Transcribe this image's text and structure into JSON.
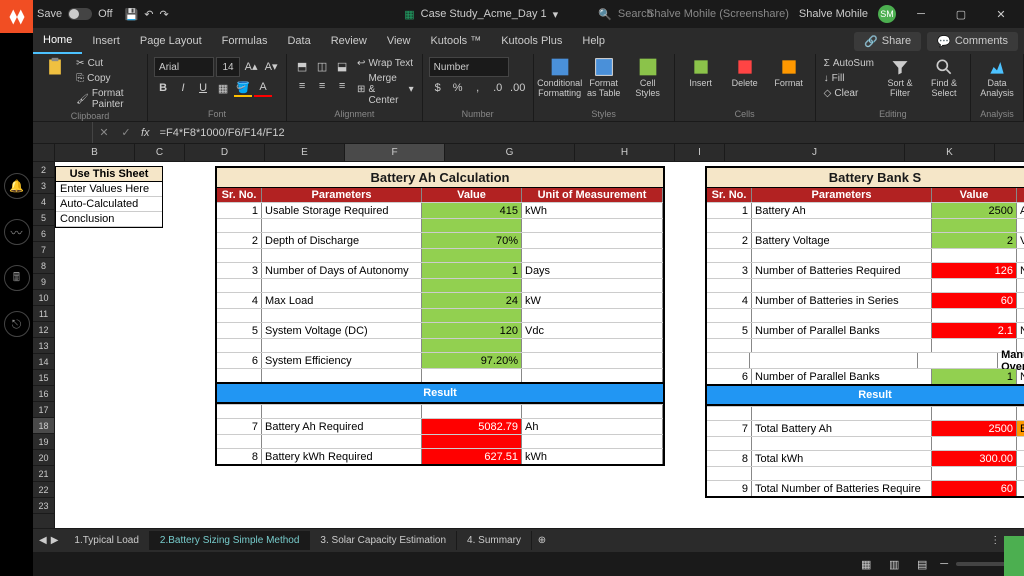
{
  "file": {
    "name": "Case Study_Acme_Day 1",
    "save": "Save",
    "on": "On",
    "off": "Off"
  },
  "search": {
    "placeholder": "Search"
  },
  "user": {
    "name": "Shalve Mohile",
    "screenshare": "Shalve Mohile (Screenshare)",
    "initials": "SM"
  },
  "tabs": {
    "home": "Home",
    "insert": "Insert",
    "layout": "Page Layout",
    "formulas": "Formulas",
    "data": "Data",
    "review": "Review",
    "view": "View",
    "kutools": "Kutools ™",
    "kutoolsplus": "Kutools Plus",
    "help": "Help",
    "share": "Share",
    "comments": "Comments"
  },
  "ribbon": {
    "clipboard": {
      "label": "Clipboard",
      "cut": "Cut",
      "copy": "Copy",
      "painter": "Format Painter"
    },
    "font": {
      "label": "Font",
      "name": "Arial",
      "size": "14"
    },
    "alignment": {
      "label": "Alignment",
      "wrap": "Wrap Text",
      "merge": "Merge & Center"
    },
    "number": {
      "label": "Number",
      "format": "Number"
    },
    "styles": {
      "label": "Styles",
      "cond": "Conditional Formatting",
      "table": "Format as Table",
      "cell": "Cell Styles"
    },
    "cells": {
      "label": "Cells",
      "insert": "Insert",
      "delete": "Delete",
      "format": "Format"
    },
    "editing": {
      "label": "Editing",
      "autosum": "AutoSum",
      "fill": "Fill",
      "clear": "Clear",
      "sort": "Sort & Filter",
      "find": "Find & Select"
    },
    "analysis": {
      "label": "Analysis",
      "data": "Data Analysis"
    }
  },
  "formula": {
    "value": "=F4*F8*1000/F6/F14/F12"
  },
  "cols": [
    "B",
    "C",
    "D",
    "E",
    "F",
    "G",
    "H",
    "I",
    "J",
    "K"
  ],
  "rows": [
    "2",
    "3",
    "4",
    "5",
    "6",
    "7",
    "8",
    "9",
    "10",
    "11",
    "12",
    "13",
    "14",
    "15",
    "16",
    "17",
    "18",
    "19",
    "20",
    "21",
    "22",
    "23"
  ],
  "legend": {
    "title": "Use This Sheet",
    "a": "Enter Values Here",
    "b": "Auto-Calculated",
    "c": "Conclusion"
  },
  "tableA": {
    "title": "Battery Ah Calculation",
    "h": {
      "sr": "Sr. No.",
      "param": "Parameters",
      "val": "Value",
      "unit": "Unit of Measurement"
    },
    "r1": {
      "sr": "1",
      "p": "Usable Storage Required",
      "v": "415",
      "u": "kWh"
    },
    "r2": {
      "sr": "2",
      "p": "Depth of Discharge",
      "v": "70%",
      "u": ""
    },
    "r3": {
      "sr": "3",
      "p": "Number of Days of Autonomy",
      "v": "1",
      "u": "Days"
    },
    "r4": {
      "sr": "4",
      "p": "Max Load",
      "v": "24",
      "u": "kW"
    },
    "r5": {
      "sr": "5",
      "p": "System Voltage (DC)",
      "v": "120",
      "u": "Vdc"
    },
    "r6": {
      "sr": "6",
      "p": "System Efficiency",
      "v": "97.20%",
      "u": ""
    },
    "result": "Result",
    "r7": {
      "sr": "7",
      "p": "Battery Ah Required",
      "v": "5082.79",
      "u": "Ah"
    },
    "r8": {
      "sr": "8",
      "p": "Battery kWh Required",
      "v": "627.51",
      "u": "kWh"
    }
  },
  "tableB": {
    "title": "Battery Bank S",
    "h": {
      "sr": "Sr. No.",
      "param": "Parameters",
      "val": "Value"
    },
    "r1": {
      "sr": "1",
      "p": "Battery Ah",
      "v": "2500",
      "u": "Ah"
    },
    "r2": {
      "sr": "2",
      "p": "Battery Voltage",
      "v": "2",
      "u": "V"
    },
    "r3": {
      "sr": "3",
      "p": "Number of Batteries Required",
      "v": "126",
      "u": "No"
    },
    "r4": {
      "sr": "4",
      "p": "Number of Batteries in Series",
      "v": "60",
      "u": ""
    },
    "r5": {
      "sr": "5",
      "p": "Number of Parallel Banks",
      "v": "2.1",
      "u": "No"
    },
    "override": "Manual Overri",
    "r6": {
      "sr": "6",
      "p": "Number of Parallel Banks",
      "v": "1",
      "u": "No"
    },
    "result": "Result",
    "r7": {
      "sr": "7",
      "p": "Total Battery Ah",
      "v": "2500",
      "u": "Ba"
    },
    "r8": {
      "sr": "8",
      "p": "Total kWh",
      "v": "300.00",
      "u": ""
    },
    "r9": {
      "sr": "9",
      "p": "Total Number of Batteries Require",
      "v": "60",
      "u": ""
    }
  },
  "sheets": {
    "s1": "1.Typical Load",
    "s2": "2.Battery Sizing Simple Method",
    "s3": "3. Solar Capacity Estimation",
    "s4": "4. Summary"
  }
}
